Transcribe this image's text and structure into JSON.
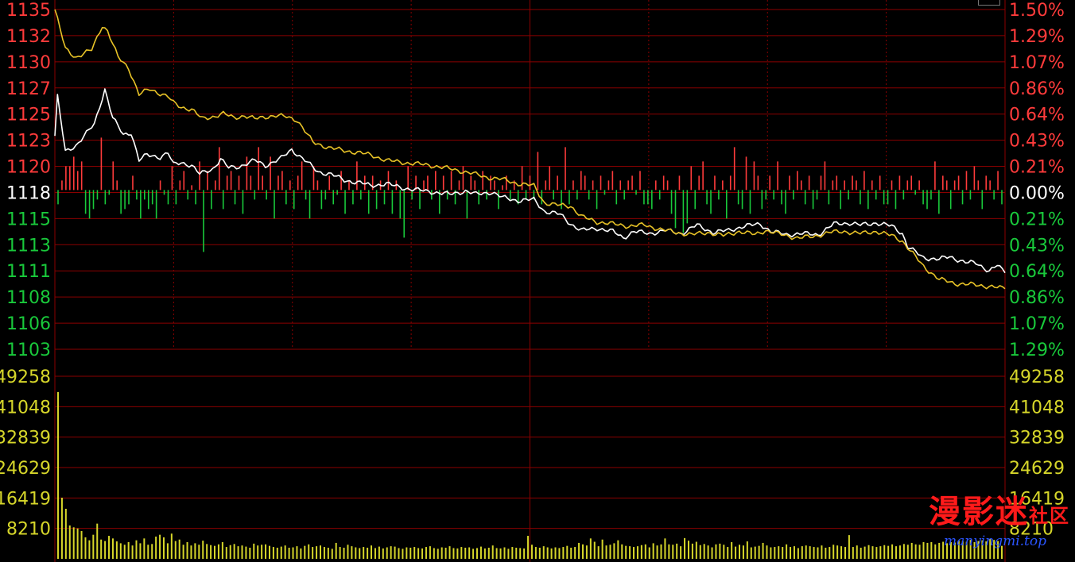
{
  "colors": {
    "background": "#000000",
    "grid": "#8b0000",
    "up": "#ff3b3b",
    "down": "#19c93b",
    "neutral": "#ffffff",
    "volume": "#d6d62a",
    "price_line": "#ffffff",
    "avg_line": "#e8c327"
  },
  "watermark": {
    "brand_big": "漫影迷",
    "brand_small": "社区",
    "url": "manyingmi.top"
  },
  "chart_data": [
    {
      "type": "line",
      "title": "",
      "prev_close": 1118,
      "ylim": [
        1103,
        1135
      ],
      "y_ticks_left": [
        "1135",
        "1132",
        "1130",
        "1127",
        "1125",
        "1123",
        "1120",
        "1118",
        "1115",
        "1113",
        "1111",
        "1108",
        "1106",
        "1103"
      ],
      "y_ticks_right": [
        "1.50%",
        "1.29%",
        "1.07%",
        "0.86%",
        "0.64%",
        "0.43%",
        "0.21%",
        "0.00%",
        "0.21%",
        "0.43%",
        "0.64%",
        "0.86%",
        "1.07%",
        "1.29%"
      ],
      "x_points": 240,
      "series": [
        {
          "key": "price",
          "color": "#ffffff",
          "anchors": [
            [
              0,
              1123.1
            ],
            [
              1,
              1126.8
            ],
            [
              4,
              1121.6
            ],
            [
              8,
              1122.2
            ],
            [
              15,
              1124.2
            ],
            [
              19,
              1127.5
            ],
            [
              22,
              1124.8
            ],
            [
              26,
              1123.2
            ],
            [
              29,
              1123.4
            ],
            [
              32,
              1120.8
            ],
            [
              35,
              1121.3
            ],
            [
              40,
              1121.1
            ],
            [
              43,
              1121.5
            ],
            [
              45,
              1120.4
            ],
            [
              48,
              1120.6
            ],
            [
              52,
              1120.3
            ],
            [
              55,
              1119.5
            ],
            [
              60,
              1120.0
            ],
            [
              63,
              1120.9
            ],
            [
              66,
              1120.1
            ],
            [
              70,
              1120.2
            ],
            [
              76,
              1120.8
            ],
            [
              80,
              1120.3
            ],
            [
              86,
              1121.0
            ],
            [
              90,
              1121.8
            ],
            [
              95,
              1120.8
            ],
            [
              100,
              1119.7
            ],
            [
              105,
              1119.5
            ],
            [
              110,
              1118.9
            ],
            [
              116,
              1118.7
            ],
            [
              120,
              1118.4
            ],
            [
              126,
              1118.6
            ],
            [
              132,
              1118.2
            ],
            [
              138,
              1118.0
            ],
            [
              144,
              1117.8
            ],
            [
              150,
              1117.6
            ],
            [
              156,
              1117.9
            ],
            [
              160,
              1117.6
            ],
            [
              166,
              1117.8
            ],
            [
              170,
              1117.3
            ],
            [
              176,
              1117.0
            ],
            [
              182,
              1117.1
            ],
            [
              186,
              1116.0
            ],
            [
              188,
              1115.9
            ],
            [
              192,
              1115.7
            ],
            [
              196,
              1114.8
            ],
            [
              200,
              1114.2
            ],
            [
              206,
              1114.4
            ],
            [
              212,
              1114.1
            ],
            [
              216,
              1113.5
            ],
            [
              220,
              1114.1
            ],
            [
              226,
              1113.9
            ],
            [
              232,
              1114.2
            ],
            [
              238,
              1113.9
            ],
            [
              244,
              1114.7
            ],
            [
              250,
              1114.0
            ],
            [
              256,
              1114.2
            ],
            [
              262,
              1114.6
            ],
            [
              268,
              1114.8
            ],
            [
              272,
              1114.1
            ],
            [
              278,
              1113.8
            ],
            [
              284,
              1113.9
            ],
            [
              290,
              1113.8
            ],
            [
              296,
              1114.8
            ],
            [
              302,
              1114.9
            ],
            [
              306,
              1114.7
            ],
            [
              312,
              1114.9
            ],
            [
              318,
              1114.6
            ],
            [
              322,
              1113.9
            ],
            [
              324,
              1112.7
            ],
            [
              330,
              1111.6
            ],
            [
              336,
              1111.5
            ],
            [
              340,
              1111.7
            ],
            [
              346,
              1111.2
            ],
            [
              350,
              1111.1
            ],
            [
              355,
              1110.4
            ],
            [
              358,
              1110.9
            ],
            [
              361,
              1110.2
            ]
          ]
        },
        {
          "key": "average",
          "color": "#e8c327",
          "anchors": [
            [
              0,
              1135.0
            ],
            [
              4,
              1131.3
            ],
            [
              8,
              1130.5
            ],
            [
              14,
              1131.2
            ],
            [
              18,
              1133.5
            ],
            [
              20,
              1133.0
            ],
            [
              24,
              1130.5
            ],
            [
              28,
              1129.5
            ],
            [
              32,
              1127.0
            ],
            [
              36,
              1127.5
            ],
            [
              40,
              1127.1
            ],
            [
              43,
              1126.8
            ],
            [
              45,
              1126.2
            ],
            [
              48,
              1125.8
            ],
            [
              52,
              1125.6
            ],
            [
              56,
              1124.7
            ],
            [
              60,
              1124.9
            ],
            [
              64,
              1125.2
            ],
            [
              68,
              1124.8
            ],
            [
              72,
              1125.0
            ],
            [
              76,
              1124.7
            ],
            [
              80,
              1124.9
            ],
            [
              84,
              1125.0
            ],
            [
              88,
              1124.9
            ],
            [
              92,
              1124.6
            ],
            [
              98,
              1122.5
            ],
            [
              104,
              1122.0
            ],
            [
              110,
              1121.7
            ],
            [
              116,
              1121.5
            ],
            [
              120,
              1121.3
            ],
            [
              126,
              1120.8
            ],
            [
              132,
              1120.6
            ],
            [
              140,
              1120.4
            ],
            [
              146,
              1120.2
            ],
            [
              152,
              1119.9
            ],
            [
              158,
              1119.6
            ],
            [
              164,
              1119.2
            ],
            [
              170,
              1119.0
            ],
            [
              176,
              1118.6
            ],
            [
              182,
              1118.4
            ],
            [
              186,
              1116.8
            ],
            [
              190,
              1116.6
            ],
            [
              196,
              1116.5
            ],
            [
              200,
              1115.5
            ],
            [
              206,
              1115.0
            ],
            [
              212,
              1114.8
            ],
            [
              218,
              1114.6
            ],
            [
              224,
              1114.7
            ],
            [
              230,
              1114.3
            ],
            [
              236,
              1114.0
            ],
            [
              242,
              1113.8
            ],
            [
              248,
              1114.0
            ],
            [
              254,
              1113.7
            ],
            [
              260,
              1114.1
            ],
            [
              266,
              1113.8
            ],
            [
              270,
              1114.2
            ],
            [
              276,
              1113.8
            ],
            [
              282,
              1113.5
            ],
            [
              288,
              1113.6
            ],
            [
              294,
              1114.0
            ],
            [
              300,
              1114.1
            ],
            [
              306,
              1113.9
            ],
            [
              312,
              1114.1
            ],
            [
              318,
              1113.7
            ],
            [
              322,
              1113.2
            ],
            [
              326,
              1112.0
            ],
            [
              330,
              1110.8
            ],
            [
              336,
              1109.6
            ],
            [
              342,
              1109.2
            ],
            [
              348,
              1109.1
            ],
            [
              352,
              1109.0
            ],
            [
              356,
              1108.9
            ],
            [
              361,
              1108.7
            ]
          ]
        }
      ],
      "ticks_up_down": {
        "unit": "relative",
        "values": [
          -0.3,
          0.2,
          0.5,
          0.5,
          0.7,
          0.4,
          0.6,
          -0.5,
          -0.6,
          -0.4,
          -0.2,
          1.1,
          -0.3,
          -0.1,
          0.6,
          0.2,
          -0.5,
          -0.4,
          -0.3,
          0.3,
          -0.2,
          -0.6,
          -0.2,
          -0.4,
          -0.3,
          -0.6,
          0.2,
          -0.1,
          -0.3,
          0.5,
          -0.3,
          0.2,
          0.4,
          -0.2,
          0.1,
          -0.3,
          0.6,
          -1.3,
          0.4,
          -0.4,
          0.2,
          0.9,
          -0.4,
          0.3,
          0.4,
          -0.3,
          0.3,
          -0.5,
          0.7,
          0.3,
          -0.2,
          0.9,
          0.3,
          -0.2,
          0.7,
          -0.6,
          0.3,
          0.4,
          -0.3,
          0.2,
          -0.4,
          0.3,
          0.6,
          -0.2,
          -0.6,
          0.5,
          0.2,
          -0.4,
          -0.2,
          0.3,
          -0.3,
          -0.1,
          0.4,
          -0.5,
          0.2,
          -0.3,
          0.6,
          -0.2,
          0.3,
          -0.5,
          0.3,
          -0.4,
          0.2,
          -0.3,
          0.4,
          -0.5,
          0.2,
          -0.6,
          -1.0,
          0.5,
          -0.2,
          0.3,
          -0.4,
          0.2,
          0.3,
          -0.2,
          0.4,
          -0.5,
          0.3,
          -0.2,
          0.4,
          -0.3,
          0.2,
          0.5,
          -0.6,
          0.3,
          0.2,
          -0.3,
          0.4,
          -0.2,
          0.3,
          0.2,
          -0.4,
          0.1,
          0.3,
          -0.2,
          0.2,
          -0.3,
          0.5,
          -0.2,
          0.3,
          -0.2,
          0.8,
          -0.3,
          0.2,
          0.5,
          -0.2,
          0.3,
          -0.4,
          0.9,
          -0.3,
          0.2,
          -0.2,
          0.4,
          0.3,
          -0.2,
          0.2,
          -0.4,
          0.3,
          -0.1,
          0.2,
          0.4,
          -0.3,
          0.2,
          -0.2,
          0.2,
          0.3,
          -0.1,
          0.4,
          -0.3,
          -0.3,
          -0.4,
          0.2,
          -0.2,
          0.3,
          0.2,
          -0.5,
          -0.8,
          0.3,
          -0.9,
          -0.7,
          0.5,
          -0.4,
          0.3,
          0.6,
          -0.3,
          -0.5,
          0.3,
          -0.2,
          0.2,
          -0.6,
          0.3,
          0.9,
          -0.3,
          -0.4,
          0.7,
          -0.5,
          0.6,
          0.3,
          -0.4,
          -0.2,
          0.3,
          -0.2,
          0.6,
          -0.3,
          -0.5,
          0.3,
          -0.2,
          0.4,
          0.2,
          -0.3,
          0.3,
          -0.4,
          -0.2,
          0.3,
          0.6,
          -0.3,
          0.2,
          0.3,
          -0.4,
          0.2,
          -0.2,
          0.3,
          0.2,
          -0.3,
          0.4,
          -0.4,
          0.2,
          -0.2,
          0.3,
          -0.3,
          -0.3,
          0.2,
          -0.4,
          0.3,
          -0.2,
          0.2,
          0.3,
          -0.1,
          0.2,
          -0.3,
          -0.4,
          -0.2,
          0.6,
          -0.5,
          0.3,
          0.2,
          -0.4,
          0.2,
          0.3,
          -0.3,
          0.4,
          -0.2,
          0.5,
          0.2,
          -0.4,
          0.3,
          0.2,
          -0.2,
          0.4,
          -0.3
        ]
      }
    },
    {
      "type": "bar",
      "title": "",
      "ylim": [
        0,
        49258
      ],
      "y_ticks_left": [
        "49258",
        "41048",
        "32839",
        "24629",
        "16419",
        "8210"
      ],
      "y_ticks_right": [
        "49258",
        "41048",
        "32839",
        "24629",
        "16419"
      ],
      "values": [
        45000,
        16500,
        13500,
        9000,
        8500,
        8200,
        7500,
        5800,
        5000,
        6500,
        9500,
        5200,
        4800,
        6200,
        5500,
        4700,
        4200,
        3800,
        4500,
        3600,
        5000,
        4200,
        5500,
        3800,
        4000,
        6000,
        6500,
        5800,
        4200,
        6800,
        4800,
        5200,
        3800,
        4500,
        3600,
        4200,
        3800,
        4900,
        4000,
        3700,
        3500,
        3900,
        4500,
        3200,
        3700,
        4000,
        3400,
        3600,
        3300,
        3000,
        4100,
        3600,
        3800,
        3900,
        3500,
        3200,
        3000,
        3300,
        3600,
        3000,
        3100,
        3400,
        2800,
        3500,
        3900,
        3200,
        3400,
        3600,
        3200,
        3000,
        2700,
        4300,
        3200,
        3000,
        3800,
        3400,
        3100,
        2900,
        3200,
        3000,
        3600,
        2900,
        3300,
        2800,
        3100,
        3400,
        3300,
        2900,
        2700,
        3100,
        3000,
        3200,
        2900,
        2800,
        3200,
        3400,
        2900,
        2700,
        3100,
        3000,
        3400,
        2900,
        2800,
        3200,
        3000,
        3100,
        2700,
        2900,
        3300,
        2800,
        3000,
        3600,
        2900,
        2800,
        3100,
        2700,
        3200,
        3000,
        2900,
        2800,
        6200,
        3800,
        3200,
        3000,
        3400,
        3100,
        2800,
        3100,
        2900,
        3200,
        3500,
        3000,
        3200,
        4300,
        3900,
        3600,
        5500,
        4600,
        3400,
        5200,
        3600,
        3800,
        4200,
        5000,
        3900,
        3500,
        3400,
        3200,
        3400,
        3700,
        3900,
        3100,
        4200,
        3600,
        3900,
        5500,
        3900,
        3800,
        4100,
        3400,
        5600,
        4900,
        4100,
        4600,
        3700,
        4000,
        3600,
        3100,
        3900,
        4100,
        3800,
        3200,
        4500,
        3300,
        3800,
        3600,
        4700,
        3100,
        3300,
        3500,
        4300,
        3600,
        3100,
        3200,
        3400,
        3200,
        3900,
        3200,
        3400,
        2900,
        3400,
        3600,
        3400,
        3200,
        3100,
        3600,
        3000,
        3200,
        3800,
        3600,
        3400,
        3200,
        6400,
        3200,
        3600,
        3000,
        3300,
        3700,
        3400,
        3200,
        3400,
        3700,
        3500,
        3900,
        3400,
        3600,
        4000,
        3800,
        4300,
        3900,
        3800,
        4500,
        4300,
        4500,
        3900,
        4300,
        4600,
        4200,
        4500,
        4400,
        4900,
        4800,
        4600,
        5100,
        4500,
        4800,
        5000,
        4700,
        5400,
        5100,
        4800,
        3500
      ]
    }
  ]
}
